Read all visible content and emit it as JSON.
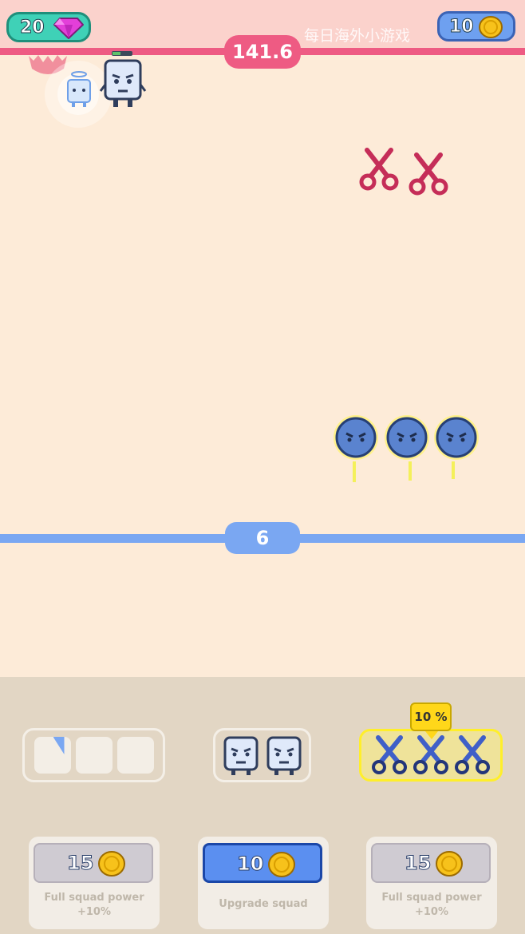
{
  "hud": {
    "gems": "20",
    "coins": "10",
    "enemy_hp": "141.6",
    "player_hp": "6",
    "watermark": "每日海外小游戏"
  },
  "colors": {
    "enemy_bar": "#ee5b83",
    "player_bar": "#7aa7f2",
    "gem": "#e33fd9",
    "coin": "#f7c21b",
    "scissors_enemy": "#c52d58",
    "scissors_squad": "#3f5fc8",
    "blob": "#5a83cf"
  },
  "icons": [
    "gem-icon",
    "coin-icon",
    "scissors-icon",
    "sawblade-icon",
    "ghost-cube-icon",
    "cube-hero-icon",
    "blob-enemy-icon"
  ],
  "squad": {
    "slot_group_1_fill": 0.2,
    "boost_badge": "10 %"
  },
  "upgrades": [
    {
      "price": "15",
      "label_line1": "Full squad power",
      "label_line2": "+10%"
    },
    {
      "price": "10",
      "label_line1": "Upgrade squad",
      "label_line2": ""
    },
    {
      "price": "15",
      "label_line1": "Full squad power",
      "label_line2": "+10%"
    }
  ]
}
